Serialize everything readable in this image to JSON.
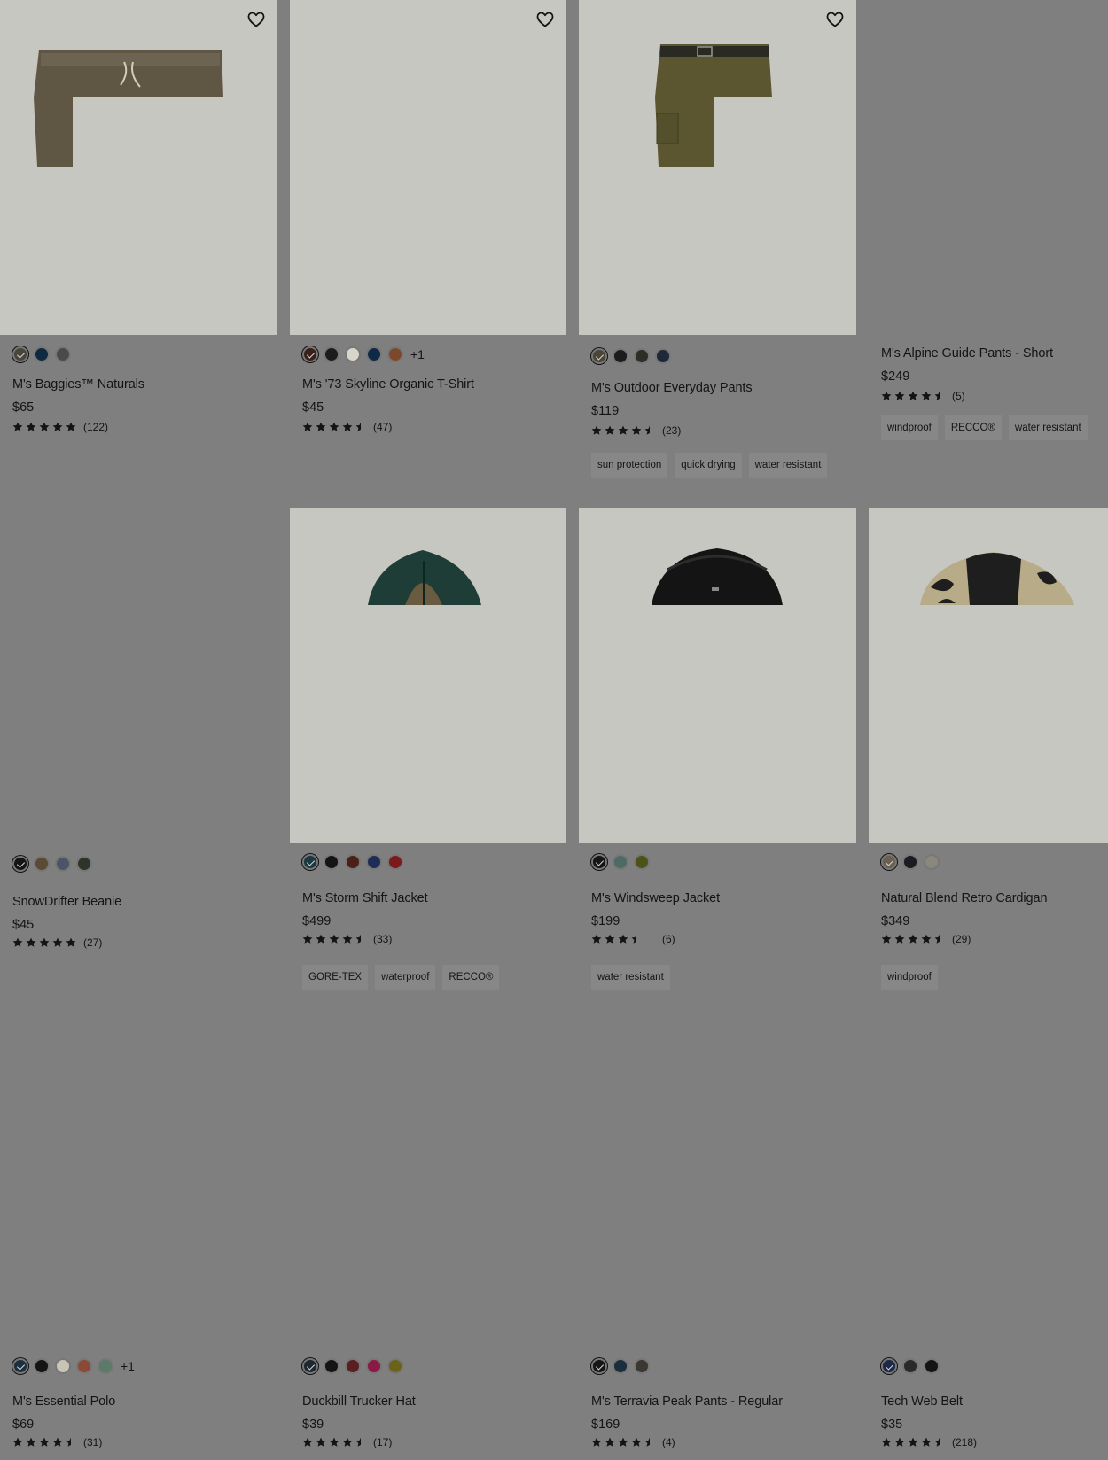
{
  "products": [
    {
      "name": "M's Baggies™ Naturals",
      "price": "$65",
      "rating": 5,
      "reviews": "(122)",
      "colors": [
        "#4a453a",
        "#0f2a3f",
        "#4a4a4a"
      ],
      "more": "",
      "tags": [],
      "image": "pants-drawstring",
      "favorite": true
    },
    {
      "name": "M's '73 Skyline Organic T-Shirt",
      "price": "$45",
      "rating": 4.5,
      "reviews": "(47)",
      "colors": [
        "#3a2018",
        "#1c1c1c",
        "#d8d5cb",
        "#0f2a45",
        "#7c4a2a"
      ],
      "more": "+1",
      "tags": [],
      "image": "none",
      "favorite": true
    },
    {
      "name": "M's Outdoor Everyday Pants",
      "price": "$119",
      "rating": 4.5,
      "reviews": "(23)",
      "colors": [
        "#4a4535",
        "#1c1c1c",
        "#2e2e26",
        "#1e2838"
      ],
      "more": "",
      "tags": [
        "sun protection",
        "quick drying",
        "water resistant"
      ],
      "image": "pants-belt",
      "favorite": true
    },
    {
      "name": "M's Alpine Guide Pants - Short",
      "price": "$249",
      "rating": 4.5,
      "reviews": "(5)",
      "colors": [],
      "more": "",
      "tags": [
        "windproof",
        "RECCO®",
        "water resistant"
      ],
      "image": "blank",
      "favorite": false
    },
    {
      "name": "SnowDrifter Beanie",
      "price": "$45",
      "rating": 5,
      "reviews": "(27)",
      "colors": [
        "#151515",
        "#5a4a36",
        "#4a5666",
        "#2f3428"
      ],
      "more": "",
      "tags": [],
      "image": "blank",
      "favorite": false
    },
    {
      "name": "M's Storm Shift Jacket",
      "price": "$499",
      "rating": 4.5,
      "reviews": "(33)",
      "colors": [
        "#1b3a40",
        "#141414",
        "#4a2018",
        "#1c2e55",
        "#7a1a1a"
      ],
      "more": "",
      "tags": [
        "GORE-TEX",
        "waterproof",
        "RECCO®"
      ],
      "image": "jacket-green",
      "favorite": false
    },
    {
      "name": "M's Windsweep Jacket",
      "price": "$199",
      "rating": 3.5,
      "reviews": "(6)",
      "colors": [
        "#151515",
        "#4c6b65",
        "#4c5218"
      ],
      "more": "",
      "tags": [
        "water resistant"
      ],
      "image": "jacket-black",
      "favorite": false
    },
    {
      "name": "Natural Blend Retro Cardigan",
      "price": "$349",
      "rating": 4.5,
      "reviews": "(29)",
      "colors": [
        "#6b6050",
        "#1a1c22",
        "#8a877d"
      ],
      "more": "",
      "tags": [
        "windproof"
      ],
      "image": "fleece",
      "favorite": false
    },
    {
      "name": "M's Essential Polo",
      "price": "$69",
      "rating": 4.5,
      "reviews": "(31)",
      "colors": [
        "#1e3040",
        "#141414",
        "#c7c5b8",
        "#8a4a35",
        "#5a7a6a"
      ],
      "more": "+1",
      "tags": [],
      "image": "blank",
      "favorite": false
    },
    {
      "name": "Duckbill Trucker Hat",
      "price": "$39",
      "rating": 4.5,
      "reviews": "(17)",
      "colors": [
        "#1e2830",
        "#141414",
        "#5a1f22",
        "#8a1a45",
        "#6b6418"
      ],
      "more": "",
      "tags": [],
      "image": "blank",
      "favorite": false
    },
    {
      "name": "M's Terravia Peak Pants - Regular",
      "price": "$169",
      "rating": 4.5,
      "reviews": "(4)",
      "colors": [
        "#151515",
        "#1a2e3c",
        "#3a3830"
      ],
      "more": "",
      "tags": [],
      "image": "blank",
      "favorite": false
    },
    {
      "name": "Tech Web Belt",
      "price": "$35",
      "rating": 4.5,
      "reviews": "(218)",
      "colors": [
        "#1c2845",
        "#2a2a2a",
        "#141414"
      ],
      "more": "",
      "tags": [],
      "image": "blank",
      "favorite": false
    }
  ]
}
